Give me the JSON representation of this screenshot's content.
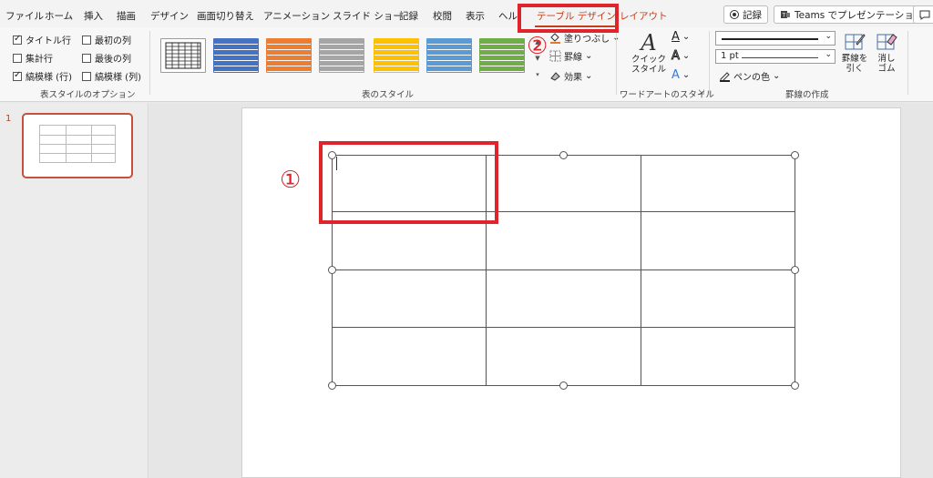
{
  "menu": {
    "items": [
      "ファイル",
      "ホーム",
      "挿入",
      "描画",
      "デザイン",
      "画面切り替え",
      "アニメーション",
      "スライド ショー",
      "記録",
      "校閲",
      "表示",
      "ヘル"
    ],
    "active_tab": "テーブル デザイン",
    "layout_tab": "レイアウト",
    "record_button": "記録",
    "teams_button": "Teams でプレゼンテーション"
  },
  "table_style_options": {
    "header_row": "タイトル行",
    "first_column": "最初の列",
    "total_row": "集計行",
    "last_column": "最後の列",
    "banded_rows": "縞模様 (行)",
    "banded_columns": "縞模様 (列)",
    "group_label": "表スタイルのオプション",
    "checked": {
      "header_row": true,
      "first_column": false,
      "total_row": false,
      "last_column": false,
      "banded_rows": true,
      "banded_columns": false
    }
  },
  "table_styles": {
    "group_label": "表のスタイル",
    "swatch_colors": [
      "#ffffff",
      "#4472c4",
      "#ed7d31",
      "#a5a5a5",
      "#ffc000",
      "#5b9bd5",
      "#70ad47"
    ],
    "shading": "塗りつぶし",
    "borders": "罫線",
    "effects": "効果"
  },
  "wordart": {
    "quick_styles_line1": "クイック",
    "quick_styles_line2": "スタイル",
    "group_label": "ワードアートのスタイル"
  },
  "draw_borders": {
    "pen_weight": "1 pt",
    "pen_color": "ペンの色",
    "draw_table_line1": "罫線を",
    "draw_table_line2": "引く",
    "eraser_line1": "消し",
    "eraser_line2": "ゴム",
    "group_label": "罫線の作成"
  },
  "slides_pane": {
    "slide_number": "1"
  },
  "annotations": {
    "callout_1": "①",
    "callout_2": "②"
  },
  "colors": {
    "accent": "#c43e1c",
    "annotation_red": "#e0242c"
  }
}
